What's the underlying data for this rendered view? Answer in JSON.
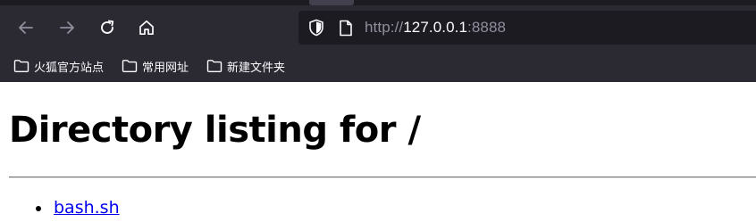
{
  "browser": {
    "toolbar": {
      "back": "back-arrow-icon",
      "forward": "forward-arrow-icon",
      "reload": "reload-icon",
      "home": "home-icon"
    },
    "url": {
      "scheme": "http://",
      "host": "127.0.0.1",
      "port": ":8888"
    },
    "bookmarks": [
      {
        "label": "火狐官方站点",
        "icon": "folder-icon"
      },
      {
        "label": "常用网址",
        "icon": "folder-icon"
      },
      {
        "label": "新建文件夹",
        "icon": "folder-icon"
      }
    ],
    "colors": {
      "chrome": "#2b2a33",
      "urlbar": "#1c1b22",
      "text": "#fbfbfe",
      "dim_text": "#8f8f9d"
    }
  },
  "page": {
    "title": "Directory listing for /",
    "files": [
      {
        "name": "bash.sh"
      }
    ],
    "colors": {
      "link": "#0000ee"
    }
  }
}
